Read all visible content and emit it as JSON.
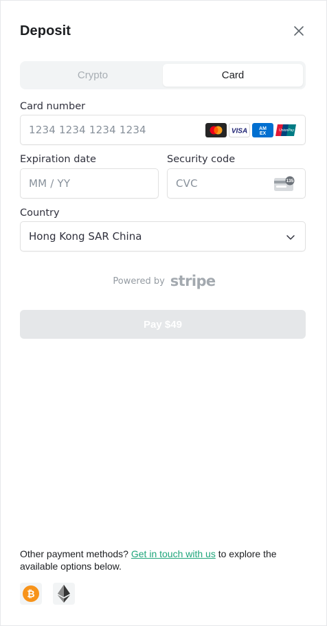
{
  "header": {
    "title": "Deposit",
    "close_icon": "close-icon"
  },
  "tabs": [
    {
      "label": "Crypto",
      "active": false
    },
    {
      "label": "Card",
      "active": true
    }
  ],
  "card_form": {
    "card_number": {
      "label": "Card number",
      "placeholder": "1234 1234 1234 1234",
      "value": ""
    },
    "card_brands": [
      "mastercard-icon",
      "visa-icon",
      "amex-icon",
      "unionpay-icon"
    ],
    "expiration": {
      "label": "Expiration date",
      "placeholder": "MM / YY"
    },
    "security_code": {
      "label": "Security code",
      "placeholder": "CVC",
      "icon": "cvc-card-icon",
      "icon_number": "135"
    },
    "country": {
      "label": "Country",
      "selected": "Hong Kong SAR China"
    }
  },
  "powered_by": {
    "text": "Powered by",
    "brand": "stripe"
  },
  "pay_button": {
    "label": "Pay $49",
    "enabled": false
  },
  "footer": {
    "prefix": "Other payment methods?",
    "link_text": "Get in touch with us",
    "suffix": "to explore the available options below.",
    "methods": [
      "bitcoin-icon",
      "ethereum-icon"
    ]
  },
  "colors": {
    "accent_link": "#1ea57a",
    "tab_bg": "#f2f4f5",
    "disabled_button": "#e5e7e9",
    "bitcoin": "#f7931a"
  }
}
